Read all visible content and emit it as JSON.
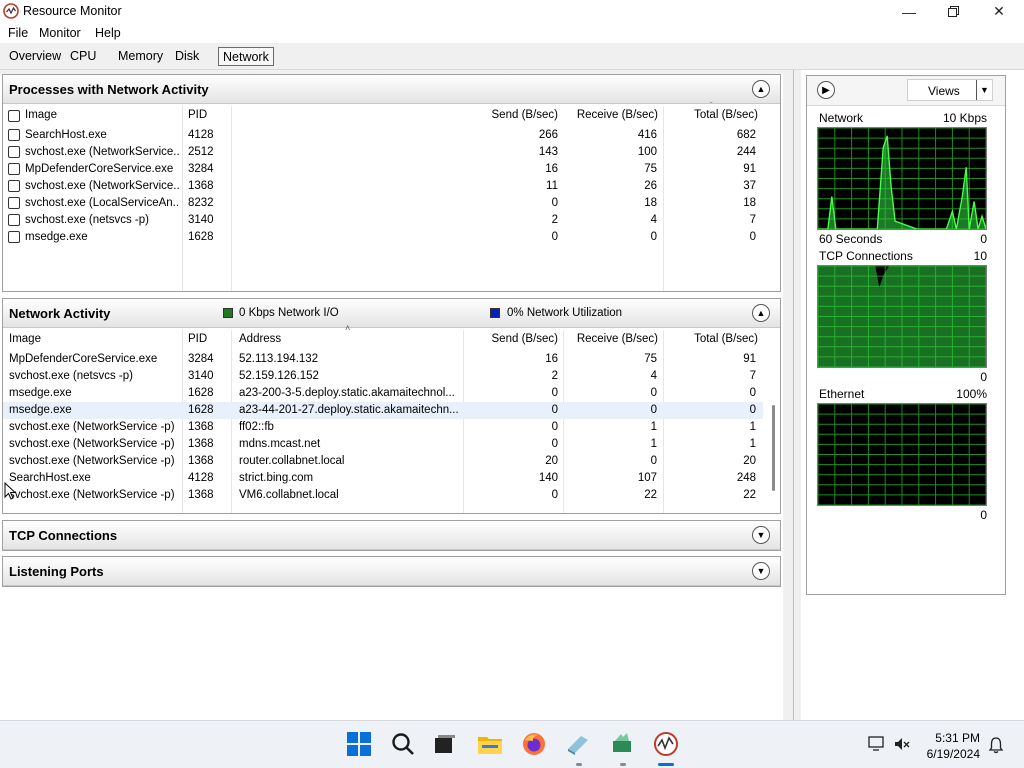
{
  "window": {
    "title": "Resource Monitor"
  },
  "menu": [
    "File",
    "Monitor",
    "Help"
  ],
  "tabs": [
    "Overview",
    "CPU",
    "Memory",
    "Disk",
    "Network"
  ],
  "active_tab": "Network",
  "processes": {
    "title": "Processes with Network Activity",
    "columns": {
      "image": "Image",
      "pid": "PID",
      "send": "Send (B/sec)",
      "receive": "Receive (B/sec)",
      "total": "Total (B/sec)"
    },
    "rows": [
      {
        "image": "SearchHost.exe",
        "pid": "4128",
        "send": "266",
        "receive": "416",
        "total": "682"
      },
      {
        "image": "svchost.exe (NetworkService...",
        "pid": "2512",
        "send": "143",
        "receive": "100",
        "total": "244"
      },
      {
        "image": "MpDefenderCoreService.exe",
        "pid": "3284",
        "send": "16",
        "receive": "75",
        "total": "91"
      },
      {
        "image": "svchost.exe (NetworkService...",
        "pid": "1368",
        "send": "11",
        "receive": "26",
        "total": "37"
      },
      {
        "image": "svchost.exe (LocalServiceAn...",
        "pid": "8232",
        "send": "0",
        "receive": "18",
        "total": "18"
      },
      {
        "image": "svchost.exe (netsvcs -p)",
        "pid": "3140",
        "send": "2",
        "receive": "4",
        "total": "7"
      },
      {
        "image": "msedge.exe",
        "pid": "1628",
        "send": "0",
        "receive": "0",
        "total": "0"
      }
    ]
  },
  "network_activity": {
    "title": "Network Activity",
    "io_label": "0 Kbps Network I/O",
    "util_label": "0% Network Utilization",
    "colors": {
      "io": "#1e7a1e",
      "util": "#0a1fb5"
    },
    "columns": {
      "image": "Image",
      "pid": "PID",
      "address": "Address",
      "send": "Send (B/sec)",
      "receive": "Receive (B/sec)",
      "total": "Total (B/sec)"
    },
    "rows": [
      {
        "image": "MpDefenderCoreService.exe",
        "pid": "3284",
        "address": "52.113.194.132",
        "send": "16",
        "receive": "75",
        "total": "91"
      },
      {
        "image": "svchost.exe (netsvcs -p)",
        "pid": "3140",
        "address": "52.159.126.152",
        "send": "2",
        "receive": "4",
        "total": "7"
      },
      {
        "image": "msedge.exe",
        "pid": "1628",
        "address": "a23-200-3-5.deploy.static.akamaitechnol...",
        "send": "0",
        "receive": "0",
        "total": "0"
      },
      {
        "image": "msedge.exe",
        "pid": "1628",
        "address": "a23-44-201-27.deploy.static.akamaitechn...",
        "send": "0",
        "receive": "0",
        "total": "0"
      },
      {
        "image": "svchost.exe (NetworkService -p)",
        "pid": "1368",
        "address": "ff02::fb",
        "send": "0",
        "receive": "1",
        "total": "1"
      },
      {
        "image": "svchost.exe (NetworkService -p)",
        "pid": "1368",
        "address": "mdns.mcast.net",
        "send": "0",
        "receive": "1",
        "total": "1"
      },
      {
        "image": "svchost.exe (NetworkService -p)",
        "pid": "1368",
        "address": "router.collabnet.local",
        "send": "20",
        "receive": "0",
        "total": "20"
      },
      {
        "image": "SearchHost.exe",
        "pid": "4128",
        "address": "strict.bing.com",
        "send": "140",
        "receive": "107",
        "total": "248"
      },
      {
        "image": "svchost.exe (NetworkService -p)",
        "pid": "1368",
        "address": "VM6.collabnet.local",
        "send": "0",
        "receive": "22",
        "total": "22"
      }
    ]
  },
  "tcp": {
    "title": "TCP Connections"
  },
  "listening": {
    "title": "Listening Ports"
  },
  "right_pane": {
    "views_label": "Views",
    "graphs": {
      "network": {
        "label": "Network",
        "max": "10 Kbps",
        "footer_left": "60 Seconds",
        "footer_right": "0"
      },
      "tcp": {
        "label": "TCP Connections",
        "max": "10",
        "footer_right": "0"
      },
      "ethernet": {
        "label": "Ethernet",
        "max": "100%",
        "footer_right": "0"
      }
    }
  },
  "taskbar": {
    "time": "5:31 PM",
    "date": "6/19/2024"
  }
}
